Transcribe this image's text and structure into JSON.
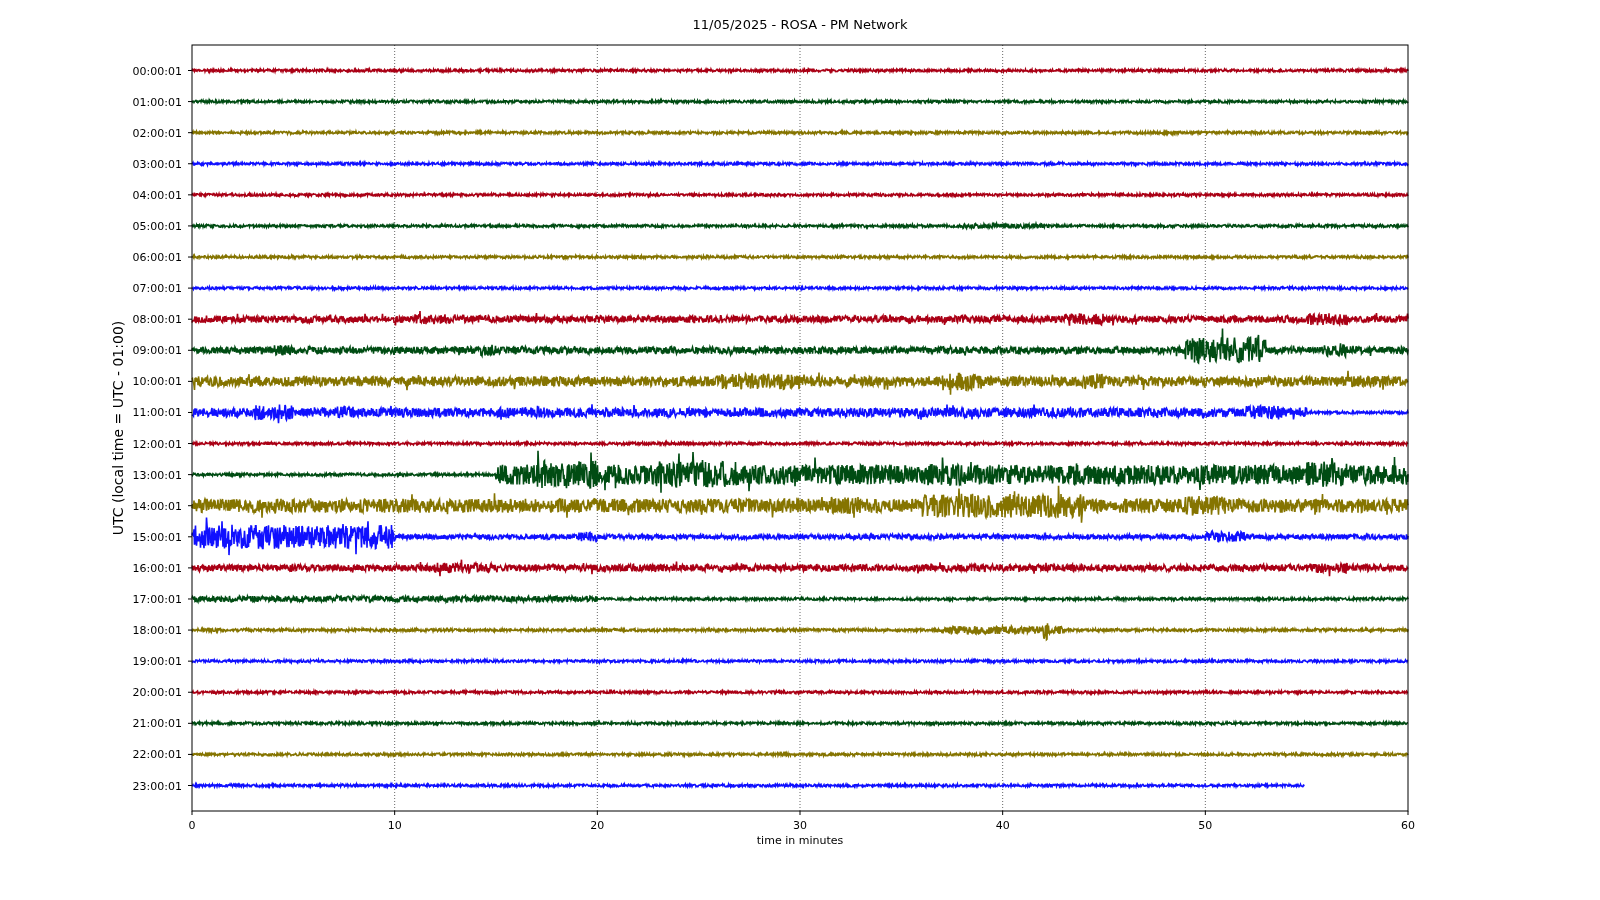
{
  "figure": {
    "title": "11/05/2025 - ROSA - PM Network",
    "ylabel": "UTC (local time = UTC - 01:00)",
    "xlabel": "time in minutes",
    "xticks": [
      "0",
      "10",
      "20",
      "30",
      "40",
      "50",
      "60"
    ],
    "traces": [
      {
        "label": "00:00:01",
        "color": "#aa0015",
        "level": 1
      },
      {
        "label": "01:00:01",
        "color": "#004c13",
        "level": 1
      },
      {
        "label": "02:00:01",
        "color": "#857400",
        "level": 1
      },
      {
        "label": "03:00:01",
        "color": "#1010ff",
        "level": 1
      },
      {
        "label": "04:00:01",
        "color": "#aa0015",
        "level": 1
      },
      {
        "label": "05:00:01",
        "color": "#004c13",
        "level": 1
      },
      {
        "label": "06:00:01",
        "color": "#857400",
        "level": 1
      },
      {
        "label": "07:00:01",
        "color": "#1010ff",
        "level": 1
      },
      {
        "label": "08:00:01",
        "color": "#aa0015",
        "level": 1
      },
      {
        "label": "09:00:01",
        "color": "#004c13",
        "level": 1
      },
      {
        "label": "10:00:01",
        "color": "#857400",
        "level": 1
      },
      {
        "label": "11:00:01",
        "color": "#1010ff",
        "level": 1
      },
      {
        "label": "12:00:01",
        "color": "#aa0015",
        "level": 1
      },
      {
        "label": "13:00:01",
        "color": "#004c13",
        "level": 1
      },
      {
        "label": "14:00:01",
        "color": "#857400",
        "level": 1
      },
      {
        "label": "15:00:01",
        "color": "#1010ff",
        "level": 1
      },
      {
        "label": "16:00:01",
        "color": "#aa0015",
        "level": 1
      },
      {
        "label": "17:00:01",
        "color": "#004c13",
        "level": 1
      },
      {
        "label": "18:00:01",
        "color": "#857400",
        "level": 1
      },
      {
        "label": "19:00:01",
        "color": "#1010ff",
        "level": 1
      },
      {
        "label": "20:00:01",
        "color": "#aa0015",
        "level": 1
      },
      {
        "label": "21:00:01",
        "color": "#004c13",
        "level": 1
      },
      {
        "label": "22:00:01",
        "color": "#857400",
        "level": 1
      },
      {
        "label": "23:00:01",
        "color": "#1010ff",
        "level": 0.915
      }
    ]
  }
}
